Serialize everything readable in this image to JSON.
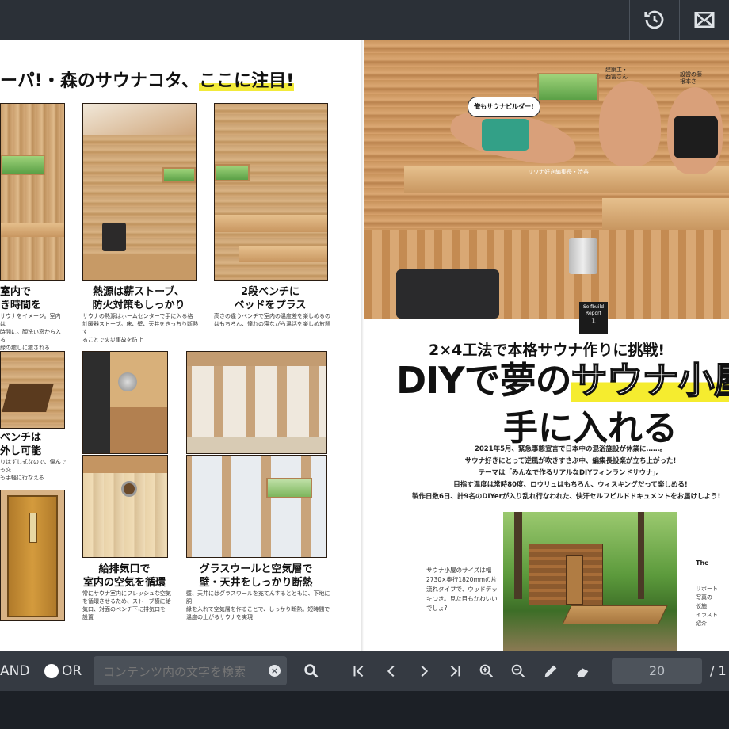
{
  "top_bar": {
    "history_icon": "history-icon",
    "mail_icon": "mail-icon"
  },
  "left_page": {
    "heading_prefix": "ーパ!・森のサウナコタ、",
    "heading_highlight": "ここに注目!",
    "captions": [
      {
        "title_l1": "室内で",
        "title_l2": "き時間を",
        "body": "サウナをイメージ。室内は\n時間に。顔洗い窓から入る\n緑の癒しに癒される"
      },
      {
        "title_l1": "熱源は薪ストーブ、",
        "title_l2": "防火対策もしっかり",
        "body": "サウナの熱源はホームセンターで手に入る格\n計暖器ストーブ。床、壁、天井をきっちり断熱す\nることで火災事故を防止"
      },
      {
        "title_l1": "2段ベンチに",
        "title_l2": "ベッドをプラス",
        "body": "高さの違うベンチで室内の温度差を楽しめるの\nはもちろん、憧れの寝ながら温活を楽しめ放題"
      },
      {
        "title_l1": "ベンチは",
        "title_l2": "外し可能",
        "body": "りはずし式なので、傷んでも交\nも手軽に行なえる"
      },
      {
        "title_l1": "給排気口で",
        "title_l2": "室内の空気を循環",
        "body": "常にサウナ室内にフレッシュな空気\nを循環させるため、ストーブ横に給\n気口、対面のベンチ下に排気口を\n設置"
      },
      {
        "title_l1": "グラスウールと空気層で",
        "title_l2": "壁・天井をしっかり断熱",
        "body": "壁、天井にはグラスウールを充てんするとともに、下地に胴\n縁を入れて空気層を作ることで、しっかり断熱。短時間で\n温度の上がるサウナを実現"
      }
    ]
  },
  "right_page": {
    "badge_l1": "Selfbuild",
    "badge_l2": "Report",
    "badge_num": "1",
    "speech": "俺もサウナビルダー!",
    "person_label_1": "リウナ好き編集長・渋谷",
    "person_label_2": "建築工・\n西富さん",
    "person_label_3": "設営の藤\n根本さ",
    "subtitle": "2×4工法で本格サウナ作りに挑戦!",
    "title_a": "DIYで夢の",
    "title_b": "サウナ小屋",
    "title_c": "手に入れる",
    "lead_lines": [
      "2021年5月、緊急事態宣言で日本中の混浴施設が休業に……。",
      "サウナ好きにとって逆風が吹きすさぶ中、編集長設楽が立ち上がった!",
      "テーマは「みんなで作るリアルなDIYフィンランドサウナ」。",
      "目指す温度は常時80度、ロウリュはもちろん、ウィスキングだって楽しめる!",
      "製作日数6日、計9名のDIYerが入り乱れ行なわれた、快汗セルフビルドドキュメントをお届けしよう!"
    ],
    "side_caption": "サウナ小屋のサイズは幅2730×奥行1820mmの片流れタイプで、ウッドデッキつき。見た目もかわいいでしょ?",
    "edge_the": "The",
    "edge_text": "リポート\n写真の\n仮施\nイラスト\n紹介"
  },
  "toolbar": {
    "and_label": "AND",
    "or_label": "OR",
    "search_placeholder": "コンテンツ内の文字を検索",
    "page_value": "20",
    "page_total": "/ 1"
  }
}
